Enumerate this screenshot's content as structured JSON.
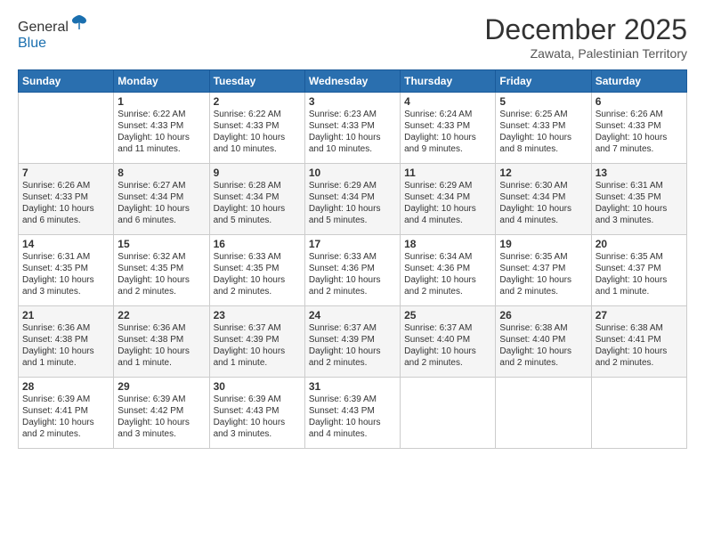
{
  "header": {
    "logo_general": "General",
    "logo_blue": "Blue",
    "month_year": "December 2025",
    "location": "Zawata, Palestinian Territory"
  },
  "days_of_week": [
    "Sunday",
    "Monday",
    "Tuesday",
    "Wednesday",
    "Thursday",
    "Friday",
    "Saturday"
  ],
  "weeks": [
    [
      {
        "day": "",
        "info": ""
      },
      {
        "day": "1",
        "info": "Sunrise: 6:22 AM\nSunset: 4:33 PM\nDaylight: 10 hours and 11 minutes."
      },
      {
        "day": "2",
        "info": "Sunrise: 6:22 AM\nSunset: 4:33 PM\nDaylight: 10 hours and 10 minutes."
      },
      {
        "day": "3",
        "info": "Sunrise: 6:23 AM\nSunset: 4:33 PM\nDaylight: 10 hours and 10 minutes."
      },
      {
        "day": "4",
        "info": "Sunrise: 6:24 AM\nSunset: 4:33 PM\nDaylight: 10 hours and 9 minutes."
      },
      {
        "day": "5",
        "info": "Sunrise: 6:25 AM\nSunset: 4:33 PM\nDaylight: 10 hours and 8 minutes."
      },
      {
        "day": "6",
        "info": "Sunrise: 6:26 AM\nSunset: 4:33 PM\nDaylight: 10 hours and 7 minutes."
      }
    ],
    [
      {
        "day": "7",
        "info": "Sunrise: 6:26 AM\nSunset: 4:33 PM\nDaylight: 10 hours and 6 minutes."
      },
      {
        "day": "8",
        "info": "Sunrise: 6:27 AM\nSunset: 4:34 PM\nDaylight: 10 hours and 6 minutes."
      },
      {
        "day": "9",
        "info": "Sunrise: 6:28 AM\nSunset: 4:34 PM\nDaylight: 10 hours and 5 minutes."
      },
      {
        "day": "10",
        "info": "Sunrise: 6:29 AM\nSunset: 4:34 PM\nDaylight: 10 hours and 5 minutes."
      },
      {
        "day": "11",
        "info": "Sunrise: 6:29 AM\nSunset: 4:34 PM\nDaylight: 10 hours and 4 minutes."
      },
      {
        "day": "12",
        "info": "Sunrise: 6:30 AM\nSunset: 4:34 PM\nDaylight: 10 hours and 4 minutes."
      },
      {
        "day": "13",
        "info": "Sunrise: 6:31 AM\nSunset: 4:35 PM\nDaylight: 10 hours and 3 minutes."
      }
    ],
    [
      {
        "day": "14",
        "info": "Sunrise: 6:31 AM\nSunset: 4:35 PM\nDaylight: 10 hours and 3 minutes."
      },
      {
        "day": "15",
        "info": "Sunrise: 6:32 AM\nSunset: 4:35 PM\nDaylight: 10 hours and 2 minutes."
      },
      {
        "day": "16",
        "info": "Sunrise: 6:33 AM\nSunset: 4:35 PM\nDaylight: 10 hours and 2 minutes."
      },
      {
        "day": "17",
        "info": "Sunrise: 6:33 AM\nSunset: 4:36 PM\nDaylight: 10 hours and 2 minutes."
      },
      {
        "day": "18",
        "info": "Sunrise: 6:34 AM\nSunset: 4:36 PM\nDaylight: 10 hours and 2 minutes."
      },
      {
        "day": "19",
        "info": "Sunrise: 6:35 AM\nSunset: 4:37 PM\nDaylight: 10 hours and 2 minutes."
      },
      {
        "day": "20",
        "info": "Sunrise: 6:35 AM\nSunset: 4:37 PM\nDaylight: 10 hours and 1 minute."
      }
    ],
    [
      {
        "day": "21",
        "info": "Sunrise: 6:36 AM\nSunset: 4:38 PM\nDaylight: 10 hours and 1 minute."
      },
      {
        "day": "22",
        "info": "Sunrise: 6:36 AM\nSunset: 4:38 PM\nDaylight: 10 hours and 1 minute."
      },
      {
        "day": "23",
        "info": "Sunrise: 6:37 AM\nSunset: 4:39 PM\nDaylight: 10 hours and 1 minute."
      },
      {
        "day": "24",
        "info": "Sunrise: 6:37 AM\nSunset: 4:39 PM\nDaylight: 10 hours and 2 minutes."
      },
      {
        "day": "25",
        "info": "Sunrise: 6:37 AM\nSunset: 4:40 PM\nDaylight: 10 hours and 2 minutes."
      },
      {
        "day": "26",
        "info": "Sunrise: 6:38 AM\nSunset: 4:40 PM\nDaylight: 10 hours and 2 minutes."
      },
      {
        "day": "27",
        "info": "Sunrise: 6:38 AM\nSunset: 4:41 PM\nDaylight: 10 hours and 2 minutes."
      }
    ],
    [
      {
        "day": "28",
        "info": "Sunrise: 6:39 AM\nSunset: 4:41 PM\nDaylight: 10 hours and 2 minutes."
      },
      {
        "day": "29",
        "info": "Sunrise: 6:39 AM\nSunset: 4:42 PM\nDaylight: 10 hours and 3 minutes."
      },
      {
        "day": "30",
        "info": "Sunrise: 6:39 AM\nSunset: 4:43 PM\nDaylight: 10 hours and 3 minutes."
      },
      {
        "day": "31",
        "info": "Sunrise: 6:39 AM\nSunset: 4:43 PM\nDaylight: 10 hours and 4 minutes."
      },
      {
        "day": "",
        "info": ""
      },
      {
        "day": "",
        "info": ""
      },
      {
        "day": "",
        "info": ""
      }
    ]
  ]
}
